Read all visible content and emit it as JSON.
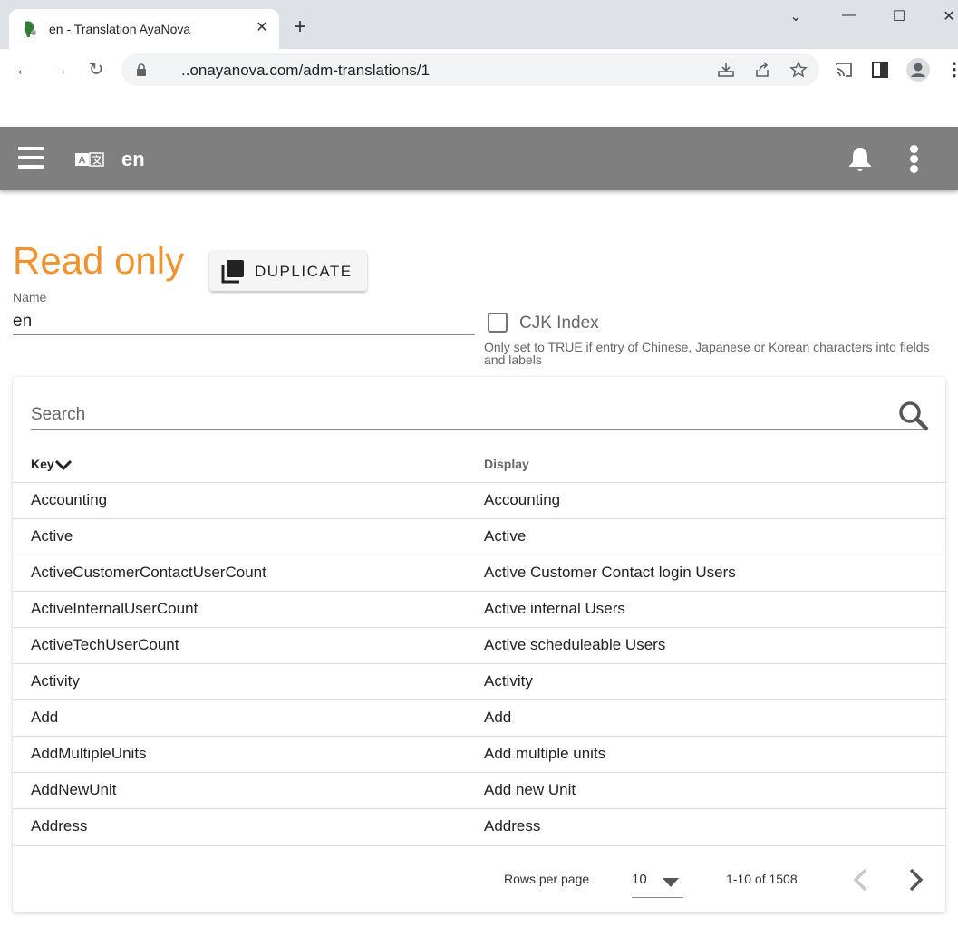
{
  "browser": {
    "tab_title": "en - Translation AyaNova",
    "url": "..onayanova.com/adm-translations/1"
  },
  "appbar": {
    "title": "en"
  },
  "form": {
    "status": "Read only",
    "duplicate_label": "DUPLICATE",
    "name_label": "Name",
    "name_value": "en",
    "cjk_label": "CJK Index",
    "cjk_hint": "Only set to TRUE if entry of Chinese, Japanese or Korean characters into fields and labels"
  },
  "table": {
    "search_placeholder": "Search",
    "headers": {
      "key": "Key",
      "display": "Display"
    },
    "rows": [
      {
        "key": "Accounting",
        "display": "Accounting"
      },
      {
        "key": "Active",
        "display": "Active"
      },
      {
        "key": "ActiveCustomerContactUserCount",
        "display": "Active Customer Contact login Users"
      },
      {
        "key": "ActiveInternalUserCount",
        "display": "Active internal Users"
      },
      {
        "key": "ActiveTechUserCount",
        "display": "Active scheduleable Users"
      },
      {
        "key": "Activity",
        "display": "Activity"
      },
      {
        "key": "Add",
        "display": "Add"
      },
      {
        "key": "AddMultipleUnits",
        "display": "Add multiple units"
      },
      {
        "key": "AddNewUnit",
        "display": "Add new Unit"
      },
      {
        "key": "Address",
        "display": "Address"
      }
    ],
    "footer": {
      "rows_per_page_label": "Rows per page",
      "rows_per_page_value": "10",
      "page_range": "1-10 of 1508"
    }
  },
  "colors": {
    "accent_orange": "#f0922e",
    "appbar_gray": "#7f7f7f"
  }
}
